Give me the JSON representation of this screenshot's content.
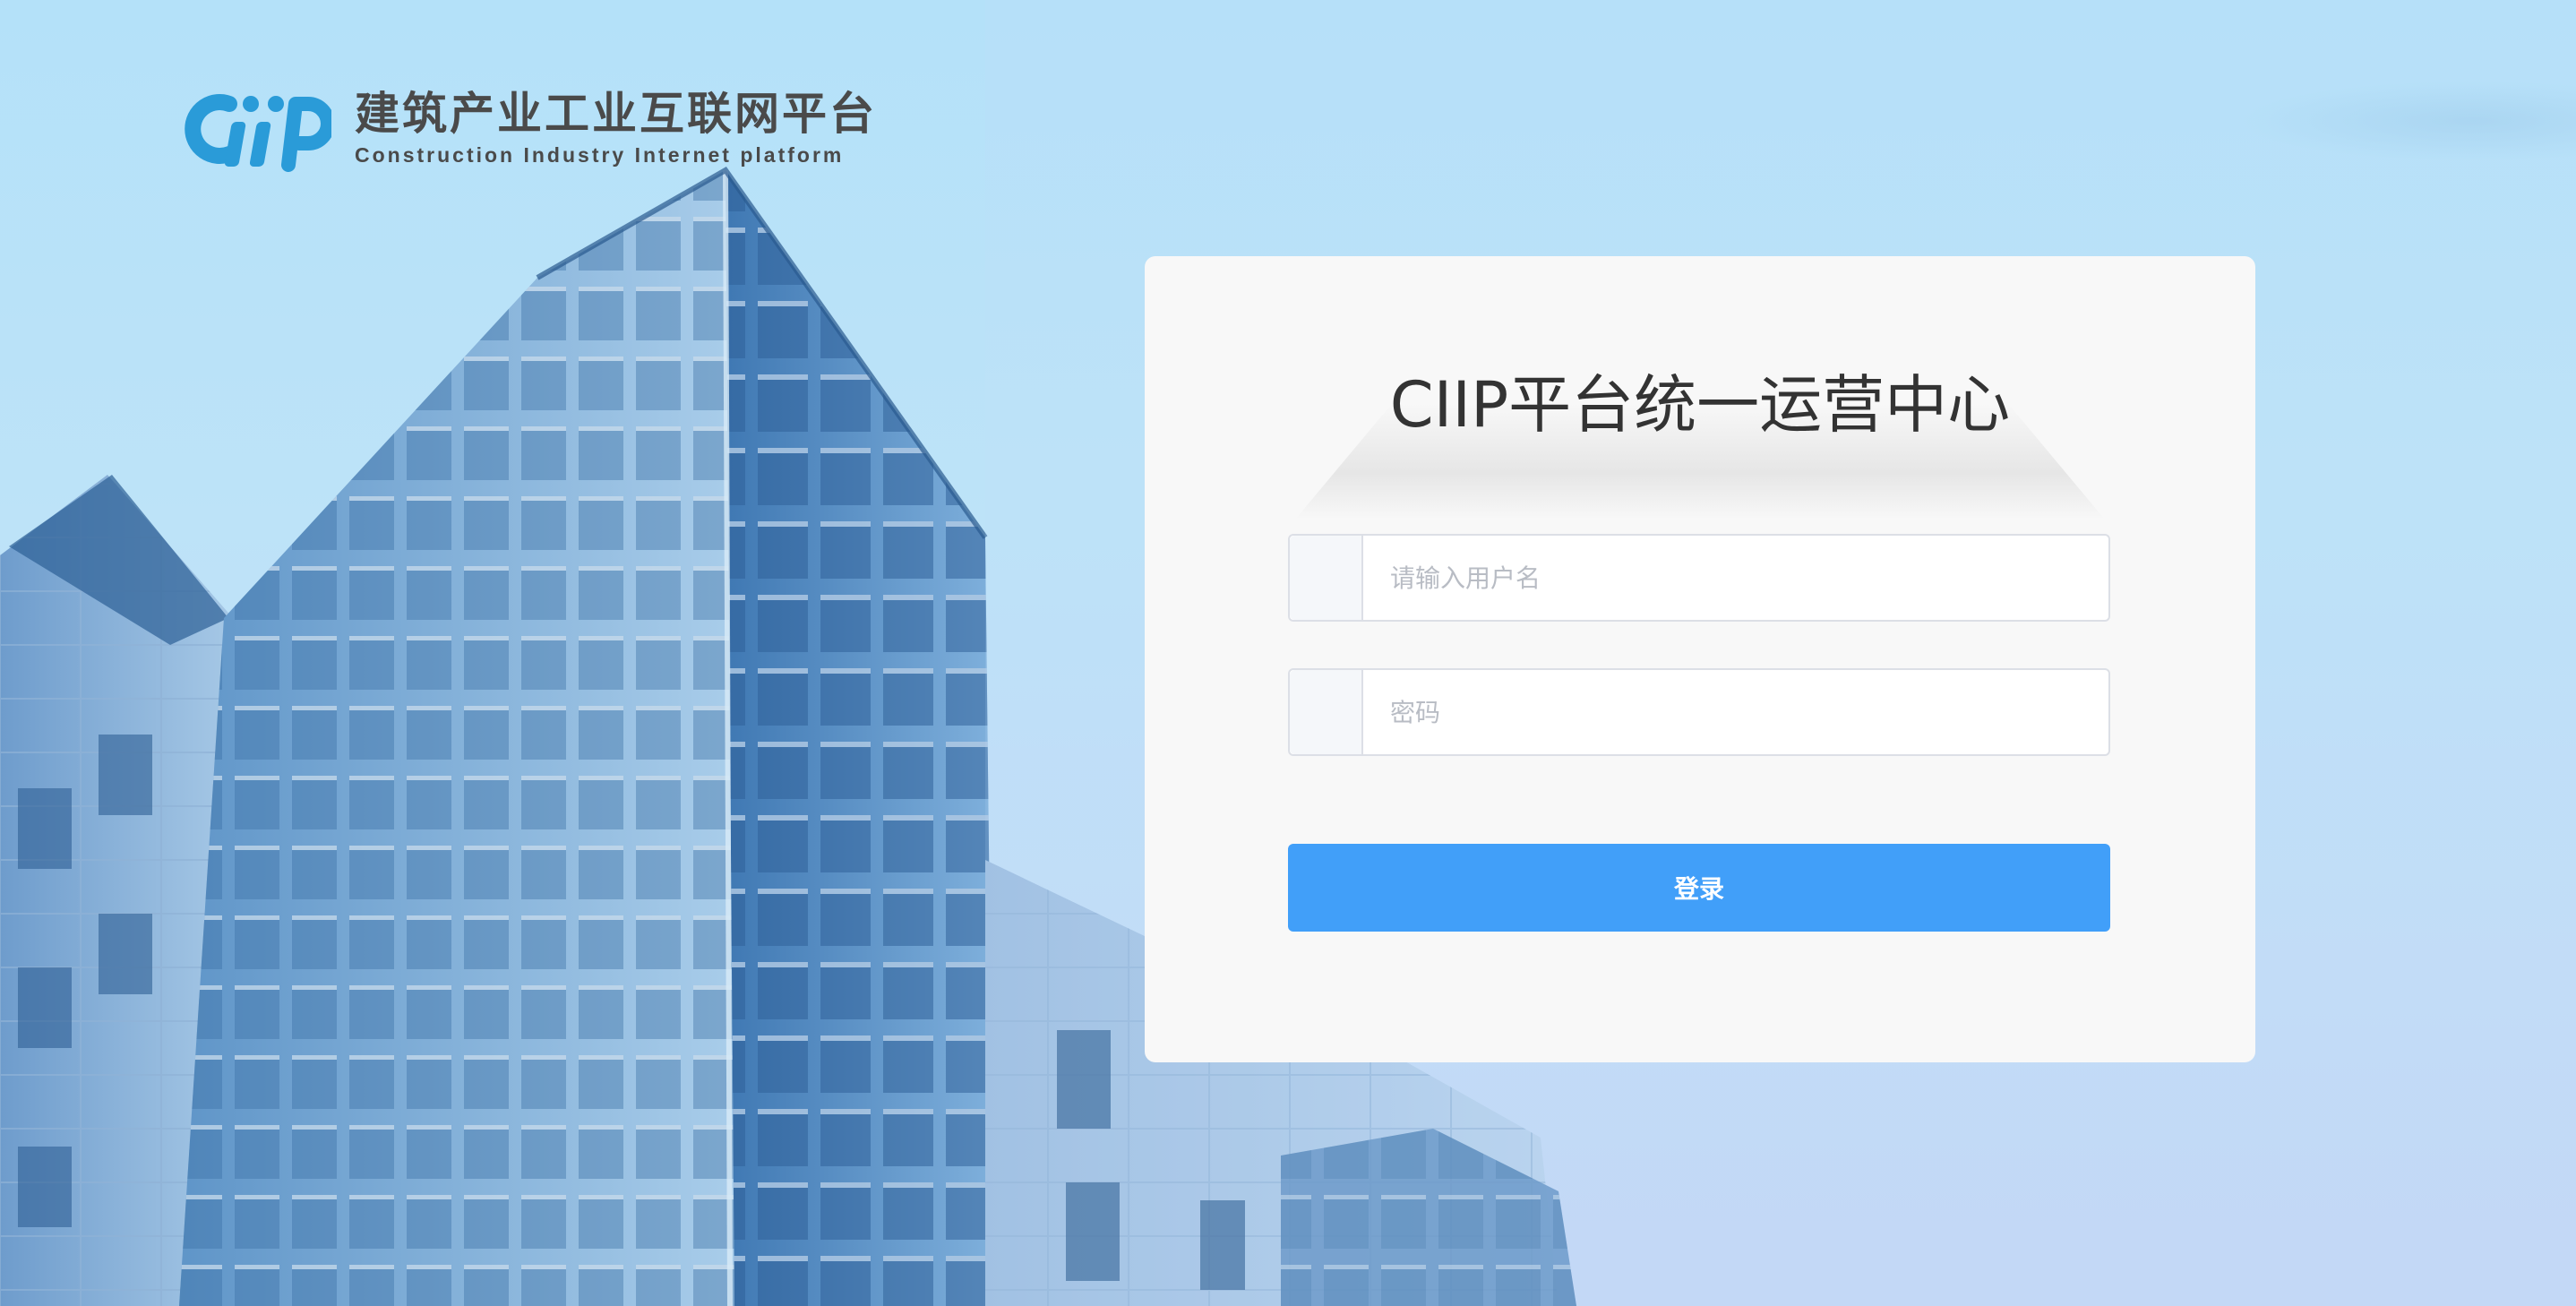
{
  "brand": {
    "logo_text_cn": "建筑产业工业互联网平台",
    "logo_text_en": "Construction Industry Internet platform",
    "accent_color": "#2a9bd8"
  },
  "login": {
    "title": "CIIP平台统一运营中心",
    "username": {
      "placeholder": "请输入用户名",
      "value": ""
    },
    "password": {
      "placeholder": "密码",
      "value": ""
    },
    "submit_label": "登录",
    "button_color": "#419ff9"
  }
}
